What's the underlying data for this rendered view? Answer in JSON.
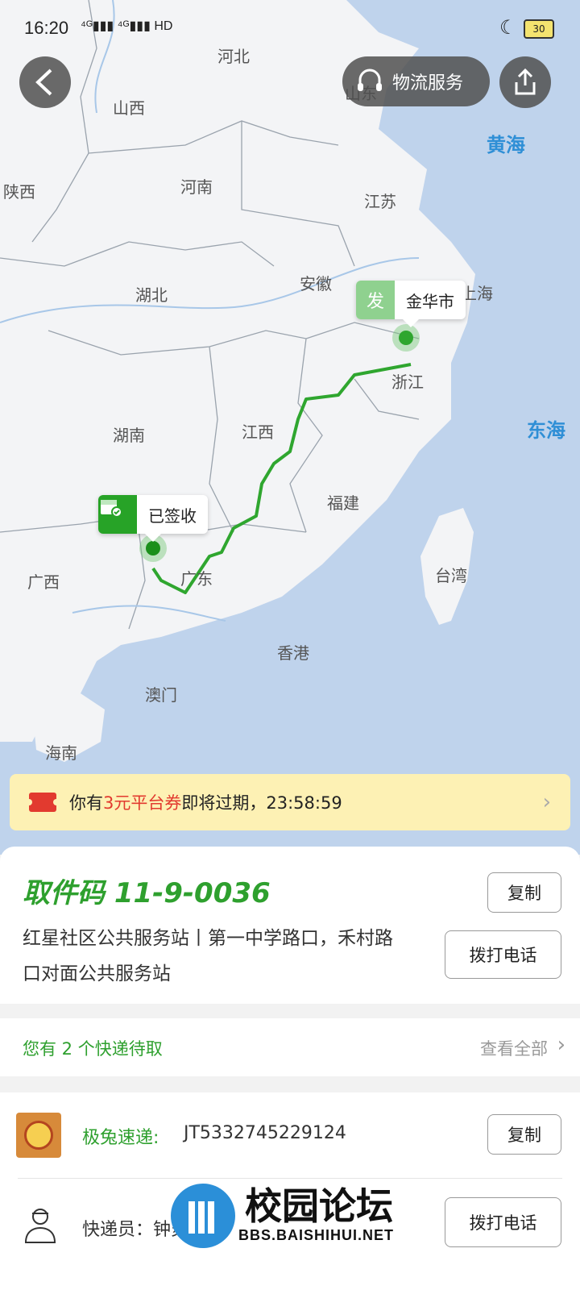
{
  "status_bar": {
    "time": "16:20",
    "signal": "⁴ᴳ▮▮▮ ⁴ᴳ▮▮▮ HD",
    "battery": "30"
  },
  "header": {
    "logistics_service": "物流服务"
  },
  "map": {
    "regions": [
      "河北",
      "山西",
      "山东",
      "陕西",
      "河南",
      "江苏",
      "安徽",
      "上海",
      "湖北",
      "浙江",
      "湖南",
      "江西",
      "福建",
      "广西",
      "广东",
      "台湾",
      "香港",
      "澳门",
      "海南"
    ],
    "seas": [
      "黄海",
      "东海"
    ],
    "origin": {
      "tag": "发",
      "label": "金华市"
    },
    "destination": {
      "label": "已签收"
    }
  },
  "coupon": {
    "prefix": "你有",
    "highlight": "3元平台券",
    "suffix": "即将过期，23:58:59"
  },
  "pickup": {
    "code_label": "取件码 11-9-0036",
    "address": "红星社区公共服务站丨第一中学路口，禾村路口对面公共服务站",
    "copy_label": "复制",
    "call_label": "拨打电话"
  },
  "pending": {
    "text": "您有 2 个快递待取",
    "view_all": "查看全部"
  },
  "shipment": {
    "company": "极兔速递:",
    "tracking": "JT5332745229124",
    "copy_label": "复制",
    "courier_label": "快递员：钟炎梅",
    "call_label": "拨打电话"
  },
  "watermark": {
    "cn": "校园论坛",
    "en": "BBS.BAISHIHUI.NET"
  },
  "colors": {
    "accent_green": "#2ea02e",
    "coupon_bg": "#fdf1b4",
    "coupon_red": "#e23a2f",
    "sea": "#bfd3ec",
    "land": "#f3f4f6"
  }
}
